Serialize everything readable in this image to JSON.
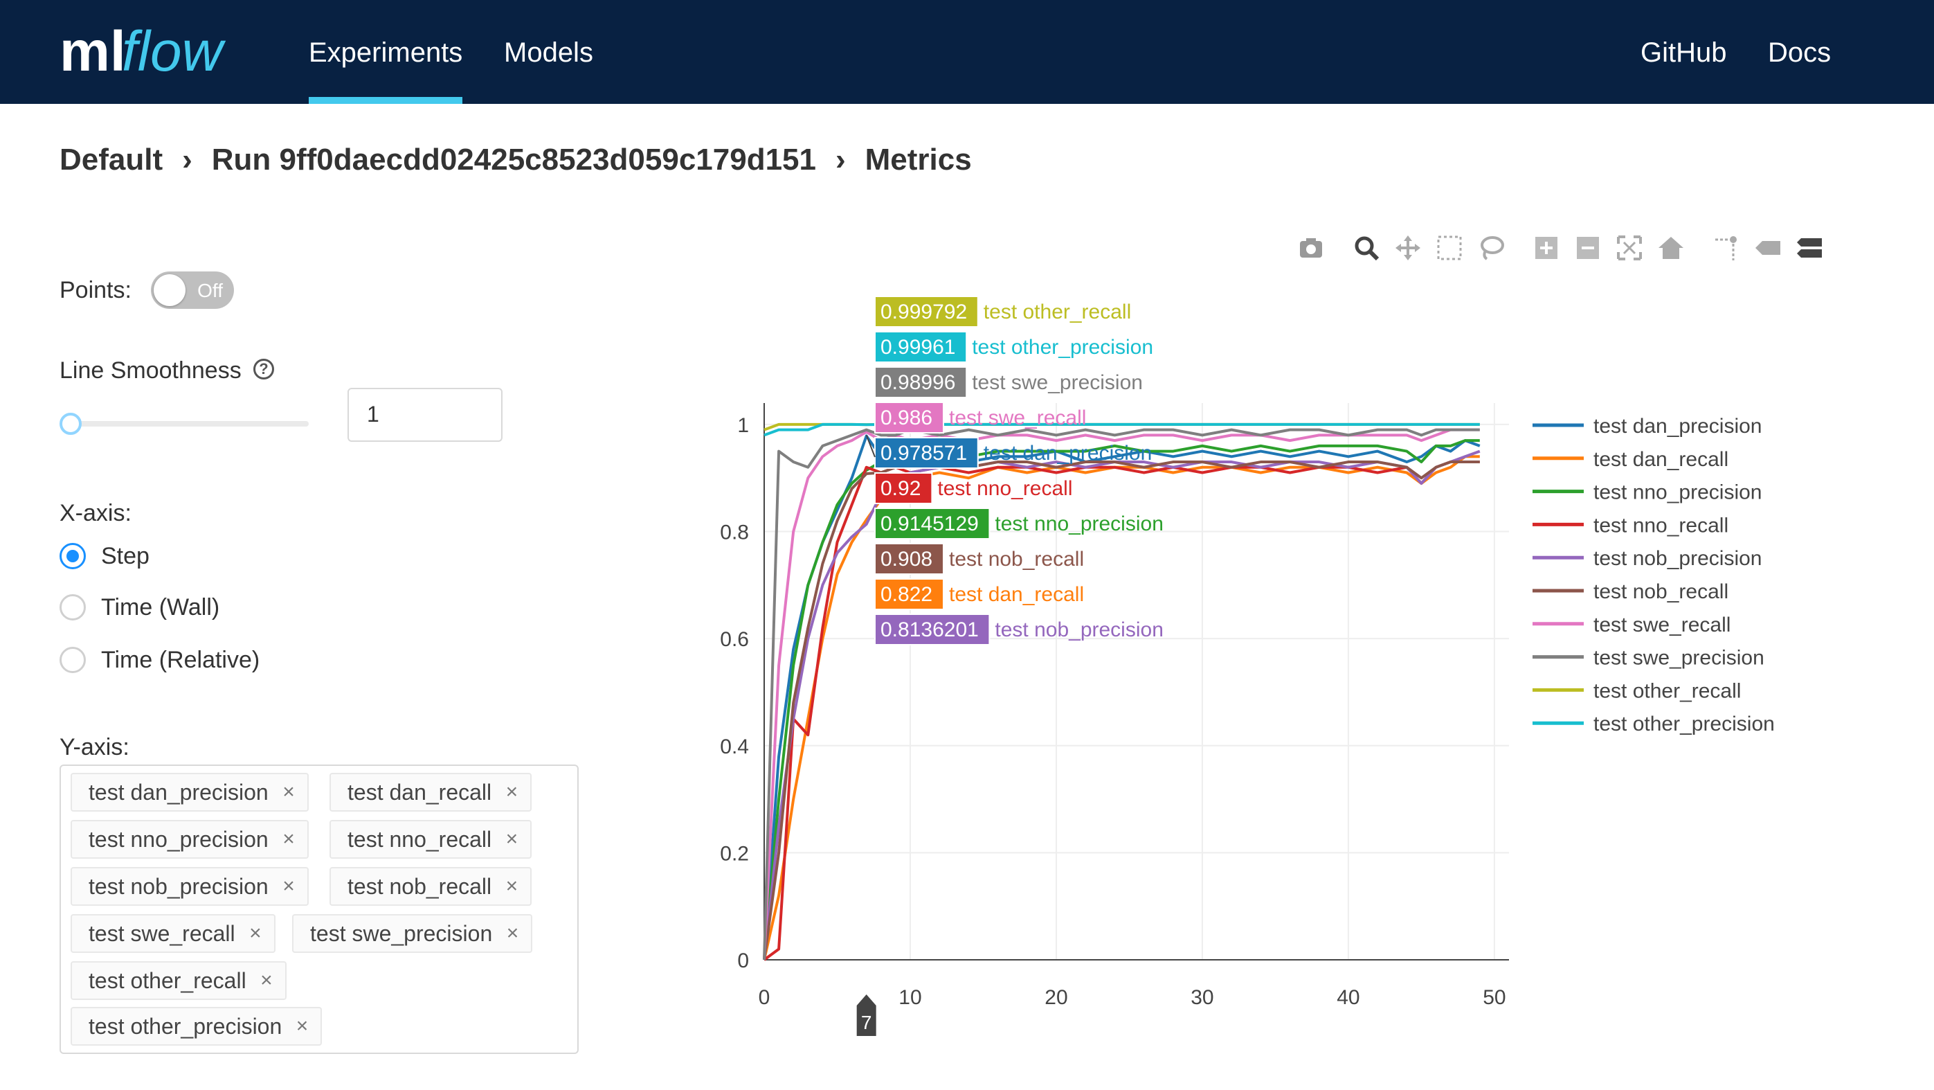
{
  "header": {
    "logo_text": "mlflow",
    "nav": [
      "Experiments",
      "Models"
    ],
    "nav_right": [
      "GitHub",
      "Docs"
    ]
  },
  "breadcrumb": {
    "experiment": "Default",
    "run": "Run 9ff0daecdd02425c8523d059c179d151",
    "page": "Metrics"
  },
  "controls": {
    "points_label": "Points:",
    "points_toggle": "Off",
    "smoothness_label": "Line Smoothness",
    "smoothness_value": "1",
    "xaxis_label": "X-axis:",
    "xaxis_options": [
      "Step",
      "Time (Wall)",
      "Time (Relative)"
    ],
    "xaxis_selected": "Step",
    "yaxis_label": "Y-axis:",
    "yaxis_tags": [
      "test dan_precision",
      "test dan_recall",
      "test nno_precision",
      "test nno_recall",
      "test nob_precision",
      "test nob_recall",
      "test swe_recall",
      "test swe_precision",
      "test other_recall",
      "test other_precision"
    ]
  },
  "modebar_icons": [
    "camera-icon",
    "zoom-icon",
    "pan-icon",
    "box-select-icon",
    "lasso-icon",
    "zoom-in-icon",
    "zoom-out-icon",
    "autoscale-icon",
    "reset-axes-icon",
    "spike-lines-icon",
    "hover-closest-icon",
    "hover-compare-icon"
  ],
  "chart_data": {
    "type": "line",
    "xlabel": "",
    "ylabel": "",
    "xlim": [
      0,
      51
    ],
    "ylim": [
      0,
      1.04
    ],
    "xticks": [
      0,
      10,
      20,
      30,
      40,
      50
    ],
    "yticks": [
      0,
      0.2,
      0.4,
      0.6,
      0.8,
      1
    ],
    "grid": true,
    "legend_position": "right",
    "hover": {
      "x": 7,
      "x_label": "7",
      "labels": [
        {
          "series": "test other_recall",
          "value": "0.999792"
        },
        {
          "series": "test other_precision",
          "value": "0.99961"
        },
        {
          "series": "test swe_precision",
          "value": "0.98996"
        },
        {
          "series": "test swe_recall",
          "value": "0.986"
        },
        {
          "series": "test dan_precision",
          "value": "0.978571"
        },
        {
          "series": "test nno_recall",
          "value": "0.92"
        },
        {
          "series": "test nno_precision",
          "value": "0.9145129"
        },
        {
          "series": "test nob_recall",
          "value": "0.908"
        },
        {
          "series": "test dan_recall",
          "value": "0.822"
        },
        {
          "series": "test nob_precision",
          "value": "0.8136201"
        }
      ]
    },
    "series": [
      {
        "name": "test dan_precision",
        "color": "#1f77b4",
        "x": [
          0,
          1,
          2,
          3,
          4,
          5,
          6,
          7,
          8,
          9,
          10,
          12,
          14,
          16,
          18,
          20,
          22,
          24,
          26,
          28,
          30,
          32,
          34,
          36,
          38,
          40,
          42,
          44,
          45,
          46,
          47,
          48,
          49
        ],
        "values": [
          0,
          0.38,
          0.58,
          0.7,
          0.78,
          0.84,
          0.9,
          0.978571,
          0.94,
          0.95,
          0.93,
          0.94,
          0.93,
          0.94,
          0.94,
          0.95,
          0.93,
          0.94,
          0.95,
          0.94,
          0.95,
          0.94,
          0.95,
          0.94,
          0.95,
          0.94,
          0.95,
          0.93,
          0.94,
          0.96,
          0.95,
          0.97,
          0.96
        ]
      },
      {
        "name": "test dan_recall",
        "color": "#ff7f0e",
        "x": [
          0,
          1,
          2,
          3,
          4,
          5,
          6,
          7,
          8,
          9,
          10,
          12,
          14,
          16,
          18,
          20,
          22,
          24,
          26,
          28,
          30,
          32,
          34,
          36,
          38,
          40,
          42,
          44,
          45,
          46,
          47,
          48,
          49
        ],
        "values": [
          0,
          0.12,
          0.3,
          0.45,
          0.6,
          0.72,
          0.78,
          0.822,
          0.86,
          0.88,
          0.9,
          0.91,
          0.9,
          0.92,
          0.91,
          0.92,
          0.91,
          0.92,
          0.92,
          0.91,
          0.92,
          0.92,
          0.91,
          0.92,
          0.92,
          0.91,
          0.92,
          0.91,
          0.89,
          0.91,
          0.92,
          0.94,
          0.94
        ]
      },
      {
        "name": "test nno_precision",
        "color": "#2ca02c",
        "x": [
          0,
          1,
          2,
          3,
          4,
          5,
          6,
          7,
          8,
          9,
          10,
          12,
          14,
          16,
          18,
          20,
          22,
          24,
          26,
          28,
          30,
          32,
          34,
          36,
          38,
          40,
          42,
          44,
          45,
          46,
          47,
          48,
          49
        ],
        "values": [
          0,
          0.3,
          0.55,
          0.7,
          0.78,
          0.85,
          0.89,
          0.9145129,
          0.93,
          0.94,
          0.94,
          0.95,
          0.94,
          0.95,
          0.95,
          0.95,
          0.95,
          0.96,
          0.95,
          0.95,
          0.96,
          0.95,
          0.96,
          0.95,
          0.96,
          0.96,
          0.96,
          0.95,
          0.93,
          0.96,
          0.96,
          0.97,
          0.97
        ]
      },
      {
        "name": "test nno_recall",
        "color": "#d62728",
        "x": [
          0,
          1,
          2,
          3,
          4,
          5,
          6,
          7,
          8,
          9,
          10,
          12,
          14,
          16,
          18,
          20,
          22,
          24,
          26,
          28,
          30,
          32,
          34,
          36,
          38,
          40,
          42,
          44,
          45,
          46,
          47,
          48,
          49
        ],
        "values": [
          0,
          0.02,
          0.45,
          0.42,
          0.62,
          0.78,
          0.85,
          0.92,
          0.91,
          0.92,
          0.91,
          0.92,
          0.91,
          0.92,
          0.92,
          0.91,
          0.92,
          0.92,
          0.91,
          0.92,
          0.91,
          0.92,
          0.92,
          0.91,
          0.92,
          0.92,
          0.91,
          0.92,
          0.89,
          0.92,
          0.93,
          0.93,
          0.93
        ]
      },
      {
        "name": "test nob_precision",
        "color": "#9467bd",
        "x": [
          0,
          1,
          2,
          3,
          4,
          5,
          6,
          7,
          8,
          9,
          10,
          12,
          14,
          16,
          18,
          20,
          22,
          24,
          26,
          28,
          30,
          32,
          34,
          36,
          38,
          40,
          42,
          44,
          45,
          46,
          47,
          48,
          49
        ],
        "values": [
          0,
          0.25,
          0.45,
          0.6,
          0.7,
          0.76,
          0.79,
          0.8136201,
          0.87,
          0.9,
          0.91,
          0.92,
          0.92,
          0.93,
          0.92,
          0.93,
          0.92,
          0.93,
          0.93,
          0.92,
          0.93,
          0.93,
          0.92,
          0.93,
          0.93,
          0.92,
          0.93,
          0.92,
          0.89,
          0.92,
          0.93,
          0.94,
          0.95
        ]
      },
      {
        "name": "test nob_recall",
        "color": "#8c564b",
        "x": [
          0,
          1,
          2,
          3,
          4,
          5,
          6,
          7,
          8,
          9,
          10,
          12,
          14,
          16,
          18,
          20,
          22,
          24,
          26,
          28,
          30,
          32,
          34,
          36,
          38,
          40,
          42,
          44,
          45,
          46,
          47,
          48,
          49
        ],
        "values": [
          0,
          0.2,
          0.48,
          0.62,
          0.74,
          0.82,
          0.88,
          0.908,
          0.91,
          0.92,
          0.92,
          0.93,
          0.92,
          0.93,
          0.93,
          0.92,
          0.93,
          0.93,
          0.92,
          0.93,
          0.93,
          0.92,
          0.93,
          0.93,
          0.92,
          0.93,
          0.93,
          0.92,
          0.9,
          0.92,
          0.93,
          0.93,
          0.93
        ]
      },
      {
        "name": "test swe_recall",
        "color": "#e377c2",
        "x": [
          0,
          1,
          2,
          3,
          4,
          5,
          6,
          7,
          8,
          9,
          10,
          12,
          14,
          16,
          18,
          20,
          22,
          24,
          26,
          28,
          30,
          32,
          34,
          36,
          38,
          40,
          42,
          44,
          45,
          46,
          47,
          48,
          49
        ],
        "values": [
          0,
          0.55,
          0.8,
          0.9,
          0.94,
          0.96,
          0.97,
          0.986,
          0.97,
          0.98,
          0.97,
          0.98,
          0.97,
          0.98,
          0.98,
          0.97,
          0.98,
          0.97,
          0.98,
          0.98,
          0.97,
          0.98,
          0.98,
          0.97,
          0.98,
          0.98,
          0.98,
          0.98,
          0.97,
          0.98,
          0.99,
          0.99,
          0.99
        ]
      },
      {
        "name": "test swe_precision",
        "color": "#7f7f7f",
        "x": [
          0,
          1,
          2,
          3,
          4,
          5,
          6,
          7,
          8,
          9,
          10,
          12,
          14,
          16,
          18,
          20,
          22,
          24,
          26,
          28,
          30,
          32,
          34,
          36,
          38,
          40,
          42,
          44,
          45,
          46,
          47,
          48,
          49
        ],
        "values": [
          0,
          0.95,
          0.93,
          0.92,
          0.96,
          0.97,
          0.98,
          0.98996,
          0.98,
          0.98,
          0.99,
          0.98,
          0.99,
          0.98,
          0.99,
          0.98,
          0.99,
          0.98,
          0.99,
          0.99,
          0.98,
          0.99,
          0.98,
          0.99,
          0.99,
          0.98,
          0.99,
          0.99,
          0.98,
          0.99,
          0.99,
          0.99,
          0.99
        ]
      },
      {
        "name": "test other_recall",
        "color": "#bcbd22",
        "x": [
          0,
          1,
          2,
          3,
          4,
          5,
          6,
          7,
          8,
          9,
          10,
          12,
          14,
          16,
          18,
          20,
          22,
          24,
          26,
          28,
          30,
          32,
          34,
          36,
          38,
          40,
          42,
          44,
          45,
          46,
          47,
          48,
          49
        ],
        "values": [
          0.99,
          1,
          1,
          1,
          1,
          1,
          1,
          0.999792,
          1,
          1,
          1,
          1,
          1,
          1,
          1,
          1,
          1,
          1,
          1,
          1,
          1,
          1,
          1,
          1,
          1,
          1,
          1,
          1,
          1,
          1,
          1,
          1,
          1
        ]
      },
      {
        "name": "test other_precision",
        "color": "#17becf",
        "x": [
          0,
          1,
          2,
          3,
          4,
          5,
          6,
          7,
          8,
          9,
          10,
          12,
          14,
          16,
          18,
          20,
          22,
          24,
          26,
          28,
          30,
          32,
          34,
          36,
          38,
          40,
          42,
          44,
          45,
          46,
          47,
          48,
          49
        ],
        "values": [
          0.98,
          0.99,
          0.99,
          0.99,
          1,
          1,
          1,
          0.99961,
          1,
          1,
          1,
          1,
          1,
          1,
          1,
          1,
          1,
          1,
          1,
          1,
          1,
          1,
          1,
          1,
          1,
          1,
          1,
          1,
          1,
          1,
          1,
          1,
          1
        ]
      }
    ]
  }
}
